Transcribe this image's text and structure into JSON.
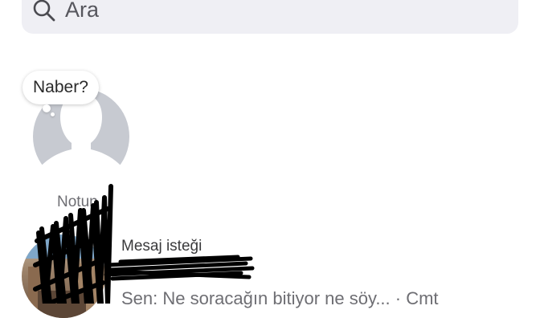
{
  "search": {
    "placeholder": "Ara",
    "icon": "search-icon"
  },
  "notes": {
    "bubble_text": "Naber?",
    "label": "Notun"
  },
  "chat": {
    "kind": "Mesaj isteği",
    "preview": "Sen: Ne soracağın bitiyor ne söy... · Cmt"
  },
  "colors": {
    "search_bg": "#efeff4",
    "avatar_placeholder": "#c7cad1",
    "redaction": "#000000"
  }
}
